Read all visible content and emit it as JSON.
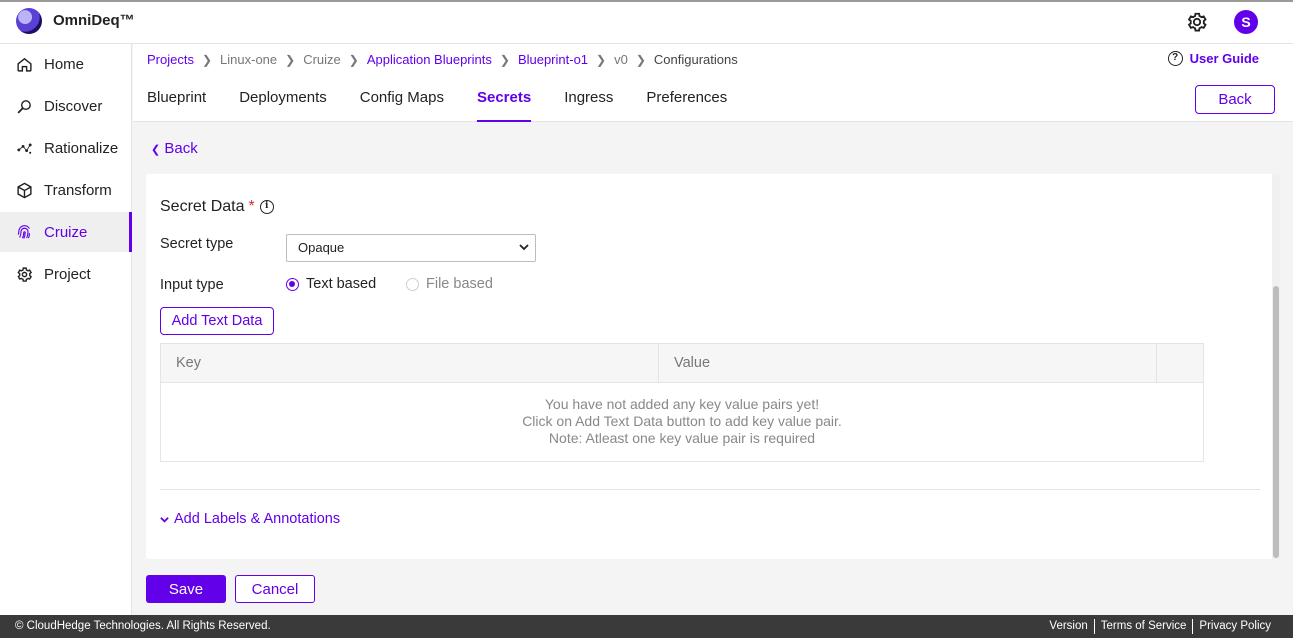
{
  "app": {
    "brand": "OmniDeq™",
    "avatar_initial": "S"
  },
  "sidebar": {
    "items": [
      {
        "label": "Home",
        "icon": "home-icon"
      },
      {
        "label": "Discover",
        "icon": "search-icon"
      },
      {
        "label": "Rationalize",
        "icon": "scatter-icon"
      },
      {
        "label": "Transform",
        "icon": "cube-icon"
      },
      {
        "label": "Cruize",
        "icon": "fingerprint-icon",
        "active": true
      },
      {
        "label": "Project",
        "icon": "gear-icon"
      }
    ]
  },
  "breadcrumb": {
    "items": [
      {
        "label": "Projects",
        "link": true
      },
      {
        "label": "Linux-one",
        "link": false
      },
      {
        "label": "Cruize",
        "link": false
      },
      {
        "label": "Application Blueprints",
        "link": true
      },
      {
        "label": "Blueprint-o1",
        "link": true
      },
      {
        "label": "v0",
        "link": false
      },
      {
        "label": "Configurations",
        "link": false
      }
    ]
  },
  "user_guide": "User Guide",
  "tabs": [
    "Blueprint",
    "Deployments",
    "Config Maps",
    "Secrets",
    "Ingress",
    "Preferences"
  ],
  "active_tab": "Secrets",
  "back_button": "Back",
  "back_link": "Back",
  "form": {
    "section_title": "Secret Data",
    "required_mark": "*",
    "secret_type_label": "Secret type",
    "secret_type_value": "Opaque",
    "input_type_label": "Input type",
    "radio_text": "Text based",
    "radio_file": "File based",
    "add_text_data": "Add Text Data",
    "table": {
      "columns": [
        "Key",
        "Value"
      ],
      "empty_lines": [
        "You have not added any key value pairs yet!",
        "Click on Add Text Data button to add key value pair.",
        "Note: Atleast one key value pair is required"
      ]
    },
    "labels_link": "Add Labels & Annotations"
  },
  "actions": {
    "save": "Save",
    "cancel": "Cancel"
  },
  "footer": {
    "copyright": "© CloudHedge Technologies. All Rights Reserved.",
    "links": [
      "Version",
      "Terms of Service",
      "Privacy Policy"
    ]
  },
  "colors": {
    "accent": "#6200ea",
    "footer_bg": "#3a3a3a"
  }
}
